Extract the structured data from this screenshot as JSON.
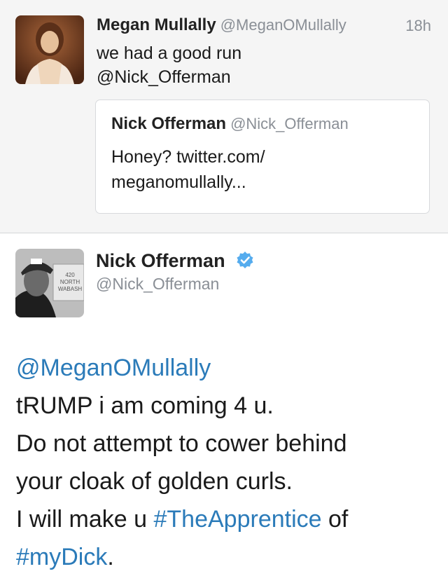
{
  "tweet1": {
    "author_name": "Megan Mullally",
    "author_handle": "@MeganOMullally",
    "time": "18h",
    "text_line1": "we had a good run",
    "text_mention": "@Nick_Offerman",
    "quoted": {
      "author_name": "Nick Offerman",
      "author_handle": "@Nick_Offerman",
      "text_line1": "Honey? twitter.com/",
      "text_line2": "meganomullally..."
    }
  },
  "tweet2": {
    "author_name": "Nick Offerman",
    "author_handle": "@Nick_Offerman",
    "avatar_sign": [
      "420",
      "NORTH",
      "WABASH"
    ],
    "body": {
      "mention": "@MeganOMullally",
      "line2": "tRUMP i am coming 4 u.",
      "line3": "Do not attempt to cower behind",
      "line4": "your cloak of golden curls.",
      "line5_prefix": "I will make u ",
      "hashtag1": "#TheApprentice",
      "line5_suffix": " of",
      "hashtag2": "#myDick",
      "line6_suffix": "."
    }
  },
  "colors": {
    "link": "#2b7bb9",
    "muted": "#8a8f96",
    "verified": "#55acee",
    "tweet1_bg": "#f5f5f5"
  }
}
